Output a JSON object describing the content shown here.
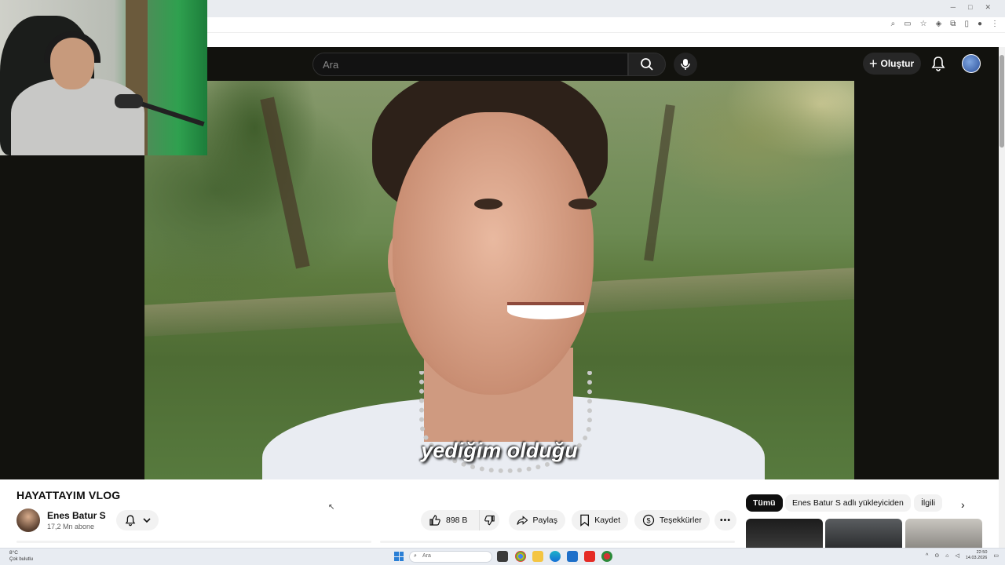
{
  "header": {
    "search_placeholder": "Ara",
    "create_label": "Oluştur"
  },
  "video": {
    "subtitle": "yediğim olduğu",
    "title": "HAYATTAYIM VLOG"
  },
  "channel": {
    "name": "Enes Batur S",
    "subscribers": "17,2 Mn abone"
  },
  "actions": {
    "like_count": "898 B",
    "share_label": "Paylaş",
    "save_label": "Kaydet",
    "thanks_label": "Teşekkürler"
  },
  "chips": {
    "all": "Tümü",
    "uploader": "Enes Batur S adlı yükleyiciden",
    "related": "İlgili"
  },
  "taskbar": {
    "weather_temp": "8°C",
    "weather_desc": "Çok bulutlu",
    "search_placeholder": "Ara",
    "time": "22:50",
    "date": "14.03.2026"
  },
  "colors": {
    "youtube_dark": "#0f0f0f",
    "pill_bg": "#f2f2f2",
    "player_bg": "#12120e",
    "accent_blue": "#2a7fd6"
  }
}
